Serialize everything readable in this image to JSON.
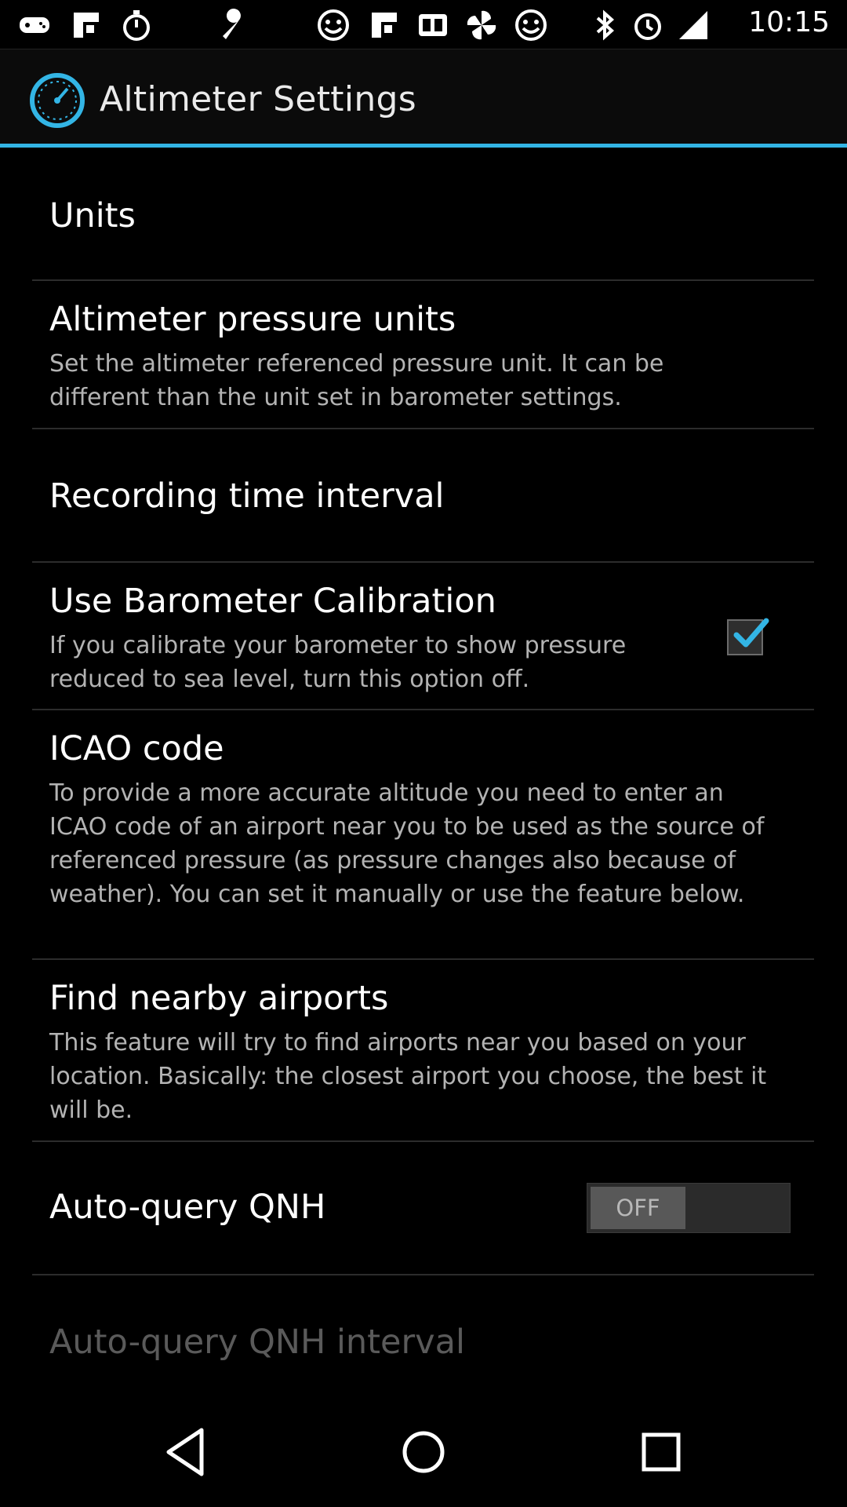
{
  "status_bar": {
    "time": "10:15",
    "icons": [
      "gamepad-icon",
      "flipboard-icon",
      "stopwatch-icon",
      "wrench-icon",
      "smiley-icon",
      "flipboard-icon",
      "qr-icon",
      "pinwheel-icon",
      "smiley-icon",
      "bluetooth-icon",
      "alarm-icon",
      "signal-icon"
    ]
  },
  "action_bar": {
    "title": "Altimeter Settings",
    "icon": "gauge-icon"
  },
  "settings": {
    "units_header": "Units",
    "pressure_units": {
      "title": "Altimeter pressure units",
      "summary": "Set the altimeter referenced pressure unit. It can be different than the unit set in barometer settings."
    },
    "recording_interval": {
      "title": "Recording time interval"
    },
    "barometer_calibration": {
      "title": "Use Barometer Calibration",
      "summary": "If you calibrate your barometer to show pressure reduced to sea level, turn this option off.",
      "checked": true
    },
    "icao_code": {
      "title": "ICAO code",
      "summary": "To provide a more accurate altitude you need to enter an ICAO code of an airport near you to be used as the source of referenced pressure (as pressure changes also because of weather). You can set it manually or use the feature below."
    },
    "nearby_airports": {
      "title": "Find nearby airports",
      "summary": "This feature will try to find airports near you based on your location. Basically: the closest airport you choose, the best it will be."
    },
    "auto_query_qnh": {
      "title": "Auto-query QNH",
      "toggle_label": "OFF"
    },
    "auto_query_interval": {
      "title": "Auto-query QNH interval"
    }
  },
  "nav_bar": {
    "back": "back-icon",
    "home": "home-icon",
    "recents": "recents-icon"
  },
  "colors": {
    "accent": "#33b5e5",
    "background": "#000000",
    "summary_text": "#b3b3b3",
    "disabled_text": "#5a5a5a"
  }
}
